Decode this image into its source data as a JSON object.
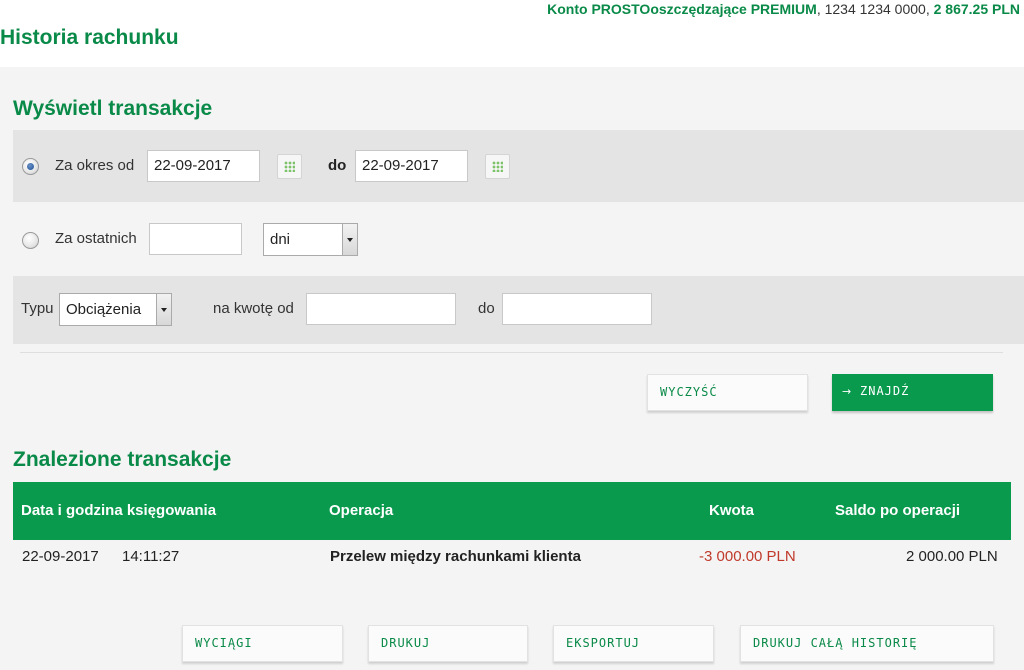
{
  "header": {
    "account_name": "Konto PROSTOoszczędzające PREMIUM",
    "account_separator": ",",
    "account_number": " 1234 1234 0000",
    "balance_separator": ",",
    "account_balance": " 2 867.25 PLN",
    "page_title": "Historia rachunku"
  },
  "filter": {
    "title": "Wyświetl transakcje",
    "period_from_label": "Za okres od",
    "period_from_value": "22-09-2017",
    "period_to_label": "do",
    "period_to_value": "22-09-2017",
    "period_selected": true,
    "last_label": "Za ostatnich",
    "last_value": "",
    "last_unit_selected": "dni",
    "type_label": "Typu",
    "type_selected": "Obciążenia",
    "amount_from_label": "na kwotę od",
    "amount_from_value": "",
    "amount_to_label": "do",
    "amount_to_value": ""
  },
  "actions": {
    "clear_label": "WYCZYŚĆ",
    "find_arrow": "→",
    "find_label": "ZNAJDŹ"
  },
  "results": {
    "title": "Znalezione transakcje",
    "columns": [
      "Data i godzina księgowania",
      "Operacja",
      "Kwota",
      "Saldo po operacji"
    ],
    "rows": [
      {
        "date": "22-09-2017",
        "time": "14:11:27",
        "operation": "Przelew między rachunkami klienta",
        "amount": "-3 000.00 PLN",
        "balance": "2 000.00 PLN"
      }
    ]
  },
  "footer_buttons": {
    "statements": "WYCIĄGI",
    "print": "DRUKUJ",
    "export": "EKSPORTUJ",
    "print_all": "DRUKUJ CAŁĄ HISTORIĘ"
  },
  "colors": {
    "brand_green": "#0a9a4e",
    "title_green": "#0a8a48",
    "negative_red": "#c0392b"
  }
}
